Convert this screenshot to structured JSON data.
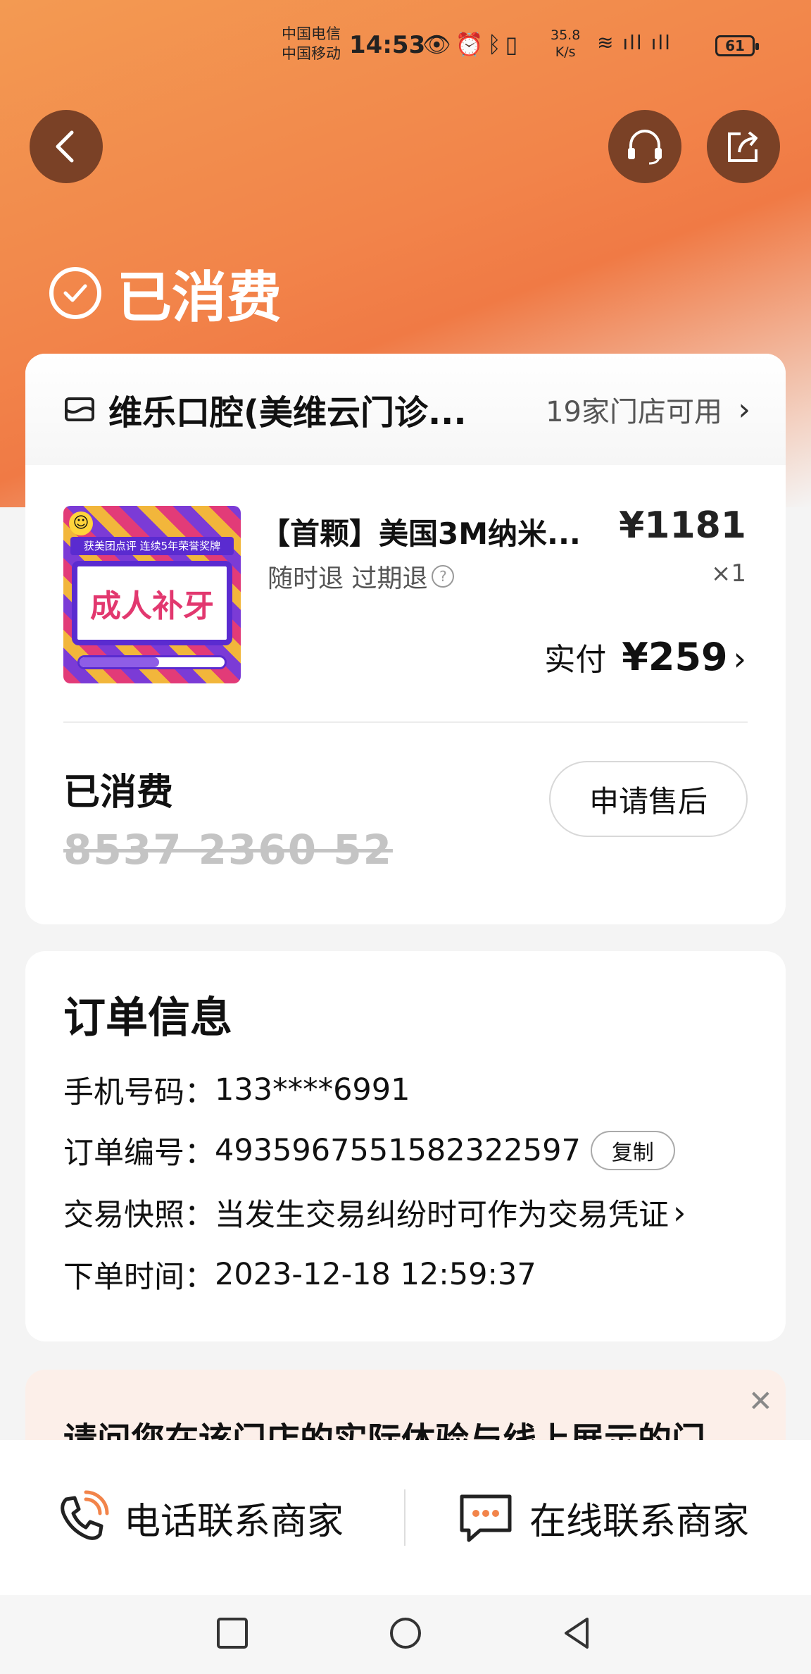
{
  "status_bar": {
    "carrier1": "中国电信",
    "carrier2": "中国移动",
    "time": "14:53",
    "speed_value": "35.8",
    "speed_unit": "K/s",
    "battery": "61"
  },
  "header": {
    "status_title": "已消费"
  },
  "store": {
    "name": "维乐口腔(美维云门诊...",
    "availability": "19家门店可用"
  },
  "product": {
    "image_banner": "获美团点评 连续5年荣誉奖牌",
    "image_text": "成人补牙",
    "image_progress": 0.55,
    "name": "【首颗】美国3M纳米...",
    "price": "¥1181",
    "tags": "随时退 过期退",
    "help_mark": "?",
    "quantity": "×1",
    "paid_label": "实付",
    "paid_amount": "¥259"
  },
  "voucher": {
    "status": "已消费",
    "code": "8537 2360 52",
    "aftersale_label": "申请售后"
  },
  "order_info": {
    "title": "订单信息",
    "phone_label": "手机号码：",
    "phone_value": "133****6991",
    "order_no_label": "订单编号：",
    "order_no_value": "4935967551582322597",
    "copy_label": "复制",
    "snapshot_label": "交易快照：",
    "snapshot_value": "当发生交易纠纷时可作为交易凭证",
    "time_label": "下单时间：",
    "time_value": "2023-12-18 12:59:37"
  },
  "survey": {
    "question": "请问您在该门店的实际体验与线上展示的门"
  },
  "bottom_actions": {
    "call_label": "电话联系商家",
    "chat_label": "在线联系商家"
  },
  "colors": {
    "header_orange": "#f2844a",
    "dark_brown": "#7a4126",
    "voucher_gray": "#c4c4c4"
  }
}
